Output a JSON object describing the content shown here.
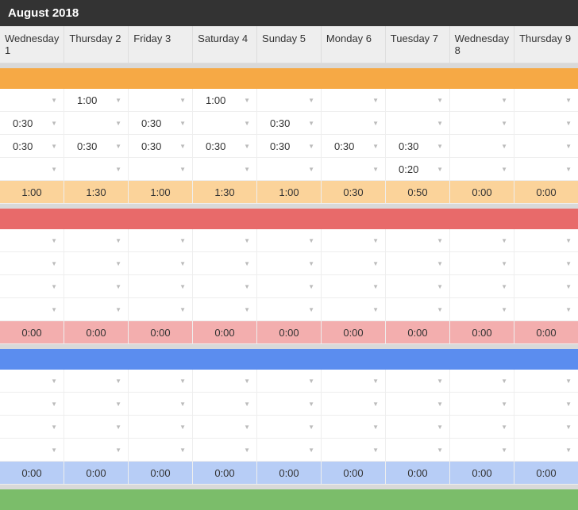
{
  "title": "August 2018",
  "columns": [
    "Wednesday 1",
    "Thursday 2",
    "Friday 3",
    "Saturday 4",
    "Sunday 5",
    "Monday 6",
    "Tuesday 7",
    "Wednesday 8",
    "Thursday 9"
  ],
  "sections": [
    {
      "name": "orange",
      "band_color": "#f6a945",
      "total_color": "#fbd39a",
      "rows": [
        [
          "",
          "1:00",
          "",
          "1:00",
          "",
          "",
          "",
          "",
          ""
        ],
        [
          "0:30",
          "",
          "0:30",
          "",
          "0:30",
          "",
          "",
          "",
          ""
        ],
        [
          "0:30",
          "0:30",
          "0:30",
          "0:30",
          "0:30",
          "0:30",
          "0:30",
          "",
          ""
        ],
        [
          "",
          "",
          "",
          "",
          "",
          "",
          "0:20",
          "",
          ""
        ]
      ],
      "total": [
        "1:00",
        "1:30",
        "1:00",
        "1:30",
        "1:00",
        "0:30",
        "0:50",
        "0:00",
        "0:00"
      ]
    },
    {
      "name": "red",
      "band_color": "#e86a6a",
      "total_color": "#f3aeae",
      "rows": [
        [
          "",
          "",
          "",
          "",
          "",
          "",
          "",
          "",
          ""
        ],
        [
          "",
          "",
          "",
          "",
          "",
          "",
          "",
          "",
          ""
        ],
        [
          "",
          "",
          "",
          "",
          "",
          "",
          "",
          "",
          ""
        ],
        [
          "",
          "",
          "",
          "",
          "",
          "",
          "",
          "",
          ""
        ]
      ],
      "total": [
        "0:00",
        "0:00",
        "0:00",
        "0:00",
        "0:00",
        "0:00",
        "0:00",
        "0:00",
        "0:00"
      ]
    },
    {
      "name": "blue",
      "band_color": "#5b8def",
      "total_color": "#b7cdf6",
      "rows": [
        [
          "",
          "",
          "",
          "",
          "",
          "",
          "",
          "",
          ""
        ],
        [
          "",
          "",
          "",
          "",
          "",
          "",
          "",
          "",
          ""
        ],
        [
          "",
          "",
          "",
          "",
          "",
          "",
          "",
          "",
          ""
        ],
        [
          "",
          "",
          "",
          "",
          "",
          "",
          "",
          "",
          ""
        ]
      ],
      "total": [
        "0:00",
        "0:00",
        "0:00",
        "0:00",
        "0:00",
        "0:00",
        "0:00",
        "0:00",
        "0:00"
      ]
    },
    {
      "name": "green",
      "band_color": "#7bbd6a",
      "rows": [],
      "total": null
    }
  ]
}
